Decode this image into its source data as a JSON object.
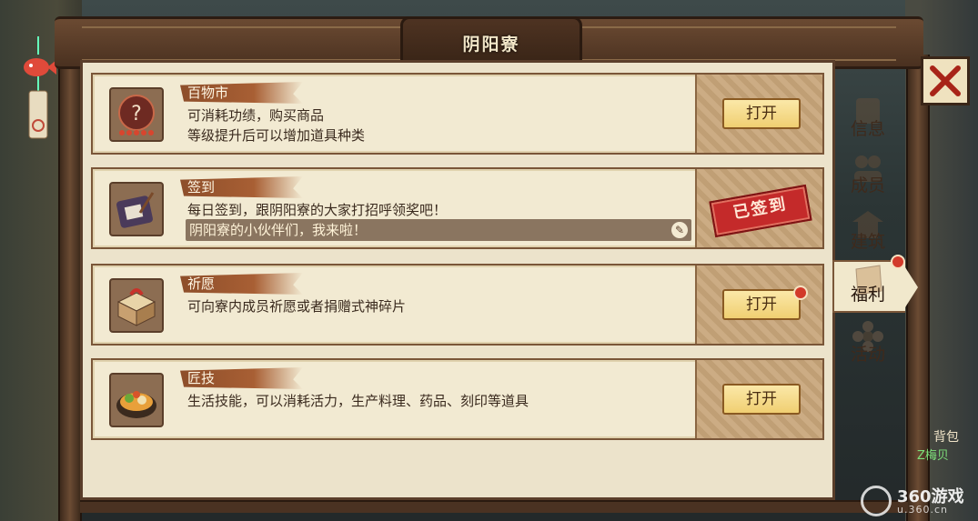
{
  "window": {
    "title": "阴阳寮"
  },
  "cards": [
    {
      "label": "百物市",
      "desc": [
        "可消耗功绩，购买商品",
        "等级提升后可以增加道具种类"
      ],
      "action": "打开",
      "icon": "mystery-item-icon"
    },
    {
      "label": "签到",
      "desc": [
        "每日签到，跟阴阳寮的大家打招呼领奖吧！"
      ],
      "chat_message": "阴阳寮的小伙伴们，我来啦！",
      "stamp": "已签到",
      "icon": "sign-in-tablet-icon"
    },
    {
      "label": "祈愿",
      "desc": [
        "可向寮内成员祈愿或者捐赠式神碎片"
      ],
      "action": "打开",
      "icon": "gift-box-icon",
      "has_notification": true
    },
    {
      "label": "匠技",
      "desc": [
        "生活技能，可以消耗活力，生产料理、药品、刻印等道具"
      ],
      "action": "打开",
      "icon": "hotpot-dish-icon"
    }
  ],
  "tabs": [
    {
      "label": "信息",
      "icon": "scroll-icon",
      "active": false
    },
    {
      "label": "成员",
      "icon": "members-icon",
      "active": false
    },
    {
      "label": "建筑",
      "icon": "building-icon",
      "active": false
    },
    {
      "label": "福利",
      "icon": "envelope-icon",
      "active": true,
      "has_notification": true
    },
    {
      "label": "活动",
      "icon": "flower-icon",
      "active": false
    }
  ],
  "close_icon": "close-icon",
  "side_labels": {
    "bag": "背包",
    "player_name": "Z梅贝"
  },
  "watermark": {
    "name": "360游戏",
    "url": "u.360.cn"
  },
  "colors": {
    "panel": "#ece3cb",
    "wood": "#5a3e2a",
    "button": "#f0cf72",
    "stamp": "#c42a2a",
    "notify": "#d23a2a"
  }
}
